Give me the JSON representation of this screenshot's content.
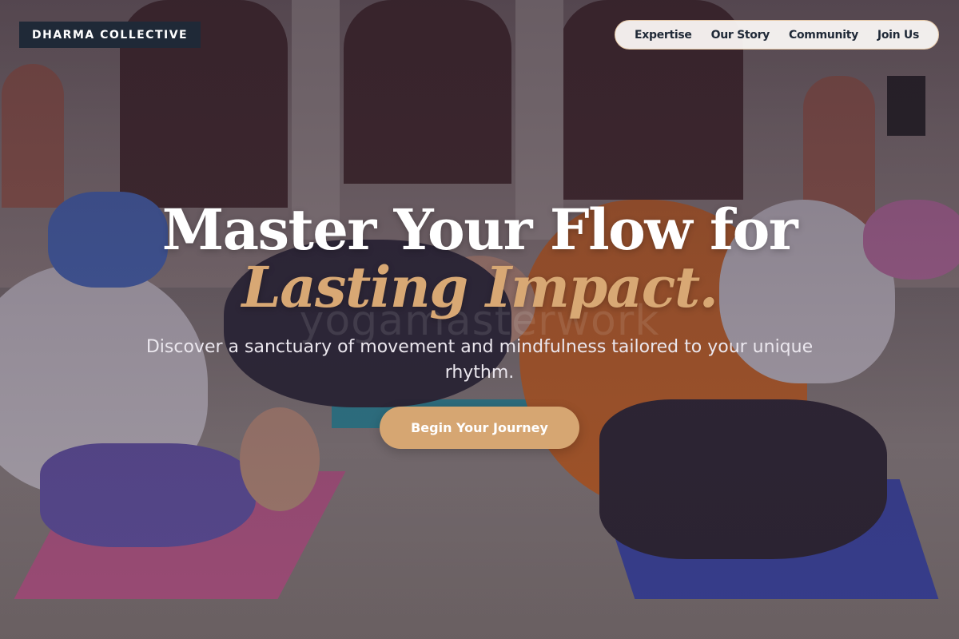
{
  "brand": {
    "name": "DHARMA COLLECTIVE"
  },
  "nav": {
    "items": [
      "Expertise",
      "Our Story",
      "Community",
      "Join Us"
    ]
  },
  "hero": {
    "headline_line1": "Master Your Flow for",
    "headline_accent": "Lasting Impact.",
    "watermark": "yogamasterwork",
    "subtitle": "Discover a sanctuary of movement and mindfulness tailored to your unique rhythm.",
    "cta_label": "Begin Your Journey",
    "background_image": "yoga-class-photo"
  },
  "colors": {
    "brand_bg": "#1f2937",
    "accent": "#d8a874",
    "cta": "#d6a672",
    "nav_bg": "#faf7f4"
  }
}
